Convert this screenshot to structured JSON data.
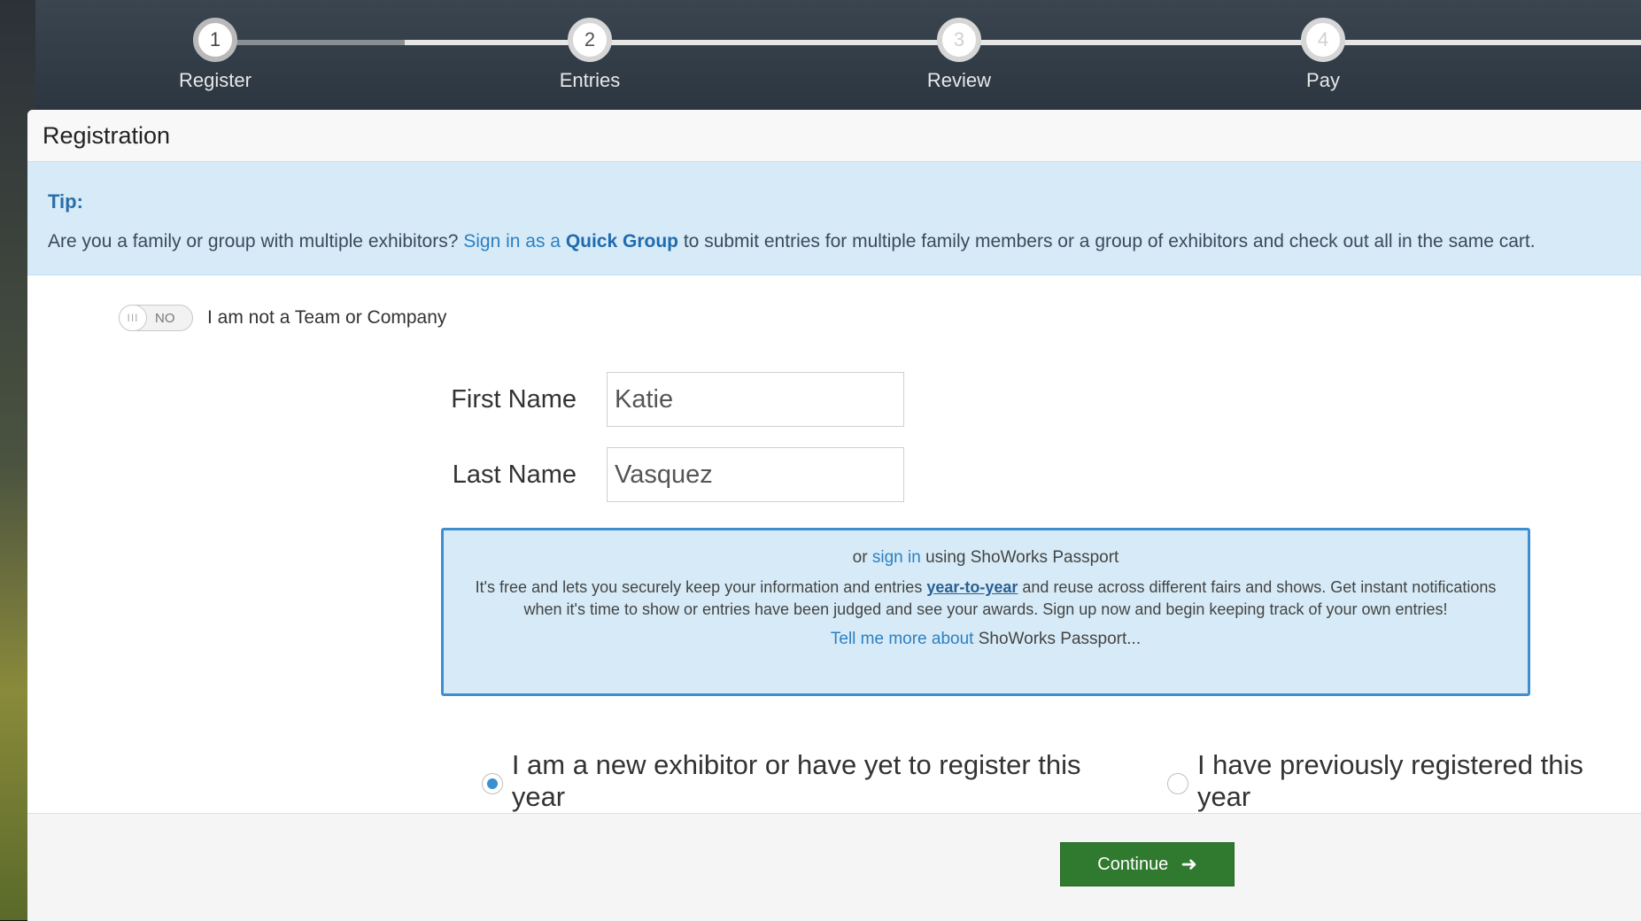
{
  "steps": [
    {
      "number": "1",
      "label": "Register"
    },
    {
      "number": "2",
      "label": "Entries"
    },
    {
      "number": "3",
      "label": "Review"
    },
    {
      "number": "4",
      "label": "Pay"
    }
  ],
  "panel": {
    "title": "Registration"
  },
  "tip": {
    "title": "Tip:",
    "text_before": "Are you a family or group with multiple exhibitors?",
    "link_sign_in": "Sign in as a",
    "link_quick_group": "Quick Group",
    "text_after": "to submit entries for multiple family members or a group of exhibitors and check out all in the same cart."
  },
  "team_toggle": {
    "knob": "III",
    "state": "NO",
    "label": "I am not a Team or Company"
  },
  "form": {
    "first_name": {
      "label": "First Name",
      "value": "Katie"
    },
    "last_name": {
      "label": "Last Name",
      "value": "Vasquez"
    }
  },
  "passport": {
    "or": "or",
    "sign_in": "sign in",
    "using": "using ShoWorks Passport",
    "body_before": "It's free and lets you securely keep your information and entries",
    "body_link": "year-to-year",
    "body_after": "and reuse across different fairs and shows. Get instant notifications when it's time to show or entries have been judged and see your awards. Sign up now and begin keeping track of your own entries!",
    "tell_more": "Tell me more about",
    "tell_more_suffix": "ShoWorks Passport..."
  },
  "exhibitor_options": [
    {
      "label": "I am a new exhibitor or have yet to register this year",
      "selected": true
    },
    {
      "label": "I have previously registered this year",
      "selected": false
    }
  ],
  "footer": {
    "continue_label": "Continue"
  },
  "colors": {
    "accent": "#2e7fc2",
    "tip_bg": "#d6ebf7",
    "continue_bg": "#2f7a2f"
  }
}
